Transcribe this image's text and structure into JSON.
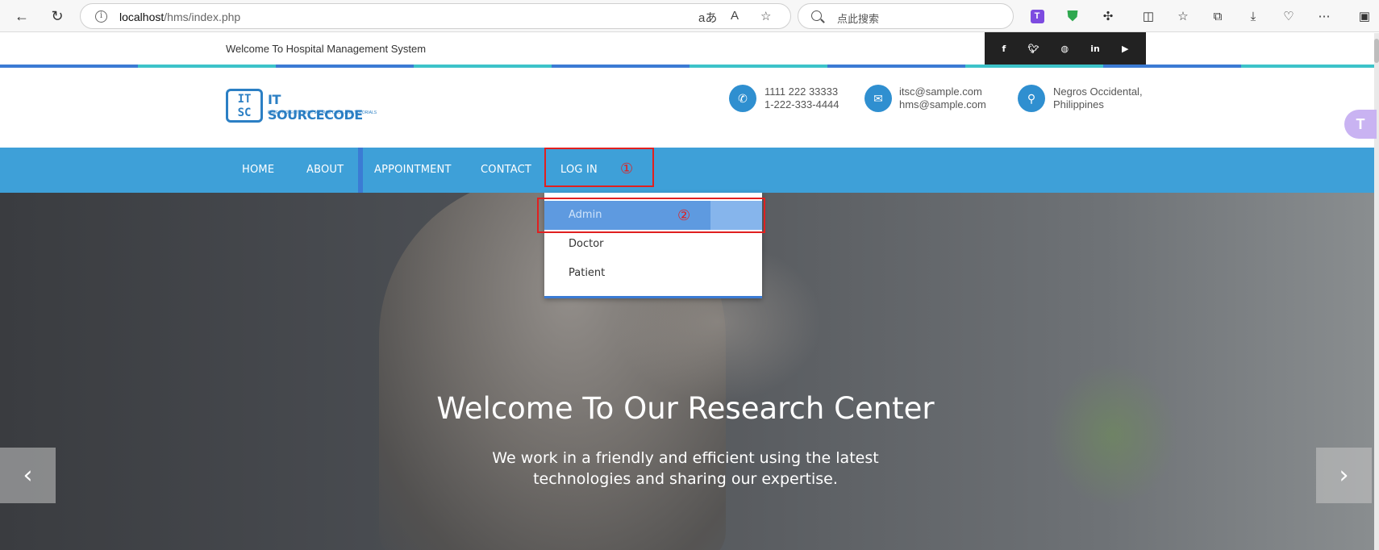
{
  "browser": {
    "url_host": "localhost",
    "url_path": "/hms/index.php",
    "search_placeholder": "点此搜索",
    "read_aloud_icon": "A",
    "translate_icon": "aあ"
  },
  "topbar": {
    "welcome": "Welcome To Hospital Management System",
    "social": [
      "f",
      "t",
      "dribbble",
      "in",
      "yt"
    ]
  },
  "header": {
    "logo_mark": "IT SC",
    "logo_name": "IT SOURCECODE",
    "logo_tagline": "FREE PROJECTS WITH SOURCE CODE AND TUTORIALS",
    "phone_1": "1111 222 33333",
    "phone_2": "1-222-333-4444",
    "email_1": "itsc@sample.com",
    "email_2": "hms@sample.com",
    "address_1": "Negros Occidental,",
    "address_2": "Philippines"
  },
  "nav": {
    "items": [
      "HOME",
      "ABOUT",
      "APPOINTMENT",
      "CONTACT",
      "LOG IN"
    ]
  },
  "dropdown": {
    "items": [
      "Admin",
      "Doctor",
      "Patient"
    ]
  },
  "hero": {
    "title": "Welcome To Our Research Center",
    "subtitle": "We work in a friendly and efficient using the latest technologies and sharing our expertise.",
    "prev": "‹",
    "next": "›"
  },
  "annotations": {
    "one": "①",
    "two": "②"
  },
  "colors": {
    "nav_bg": "#3ea0d8",
    "accent_blue": "#3b7bd4",
    "accent_teal": "#3cc3c9",
    "annotation_red": "#e02020",
    "dropdown_active": "#5e9ae0"
  }
}
